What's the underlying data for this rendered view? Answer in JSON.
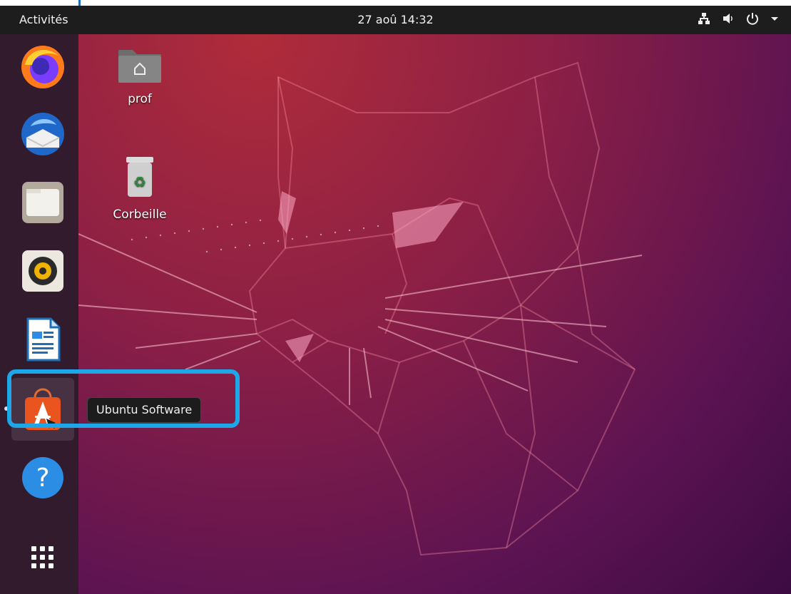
{
  "topbar": {
    "activities": "Activités",
    "clock": "27 aoû  14:32",
    "tray_icons": [
      "network-icon",
      "volume-icon",
      "power-icon",
      "menu-caret-icon"
    ]
  },
  "dock": {
    "items": [
      {
        "name": "firefox"
      },
      {
        "name": "thunderbird"
      },
      {
        "name": "files"
      },
      {
        "name": "rhythmbox"
      },
      {
        "name": "libreoffice-writer"
      },
      {
        "name": "ubuntu-software",
        "active": true
      },
      {
        "name": "help"
      },
      {
        "name": "show-applications"
      }
    ]
  },
  "desktop": {
    "icons": [
      {
        "label": "prof"
      },
      {
        "label": "Corbeille"
      }
    ]
  },
  "tooltip": {
    "text": "Ubuntu Software"
  },
  "colors": {
    "highlight": "#1da7e8",
    "topbar": "#1d1d1d",
    "dock": "#311b2d"
  }
}
